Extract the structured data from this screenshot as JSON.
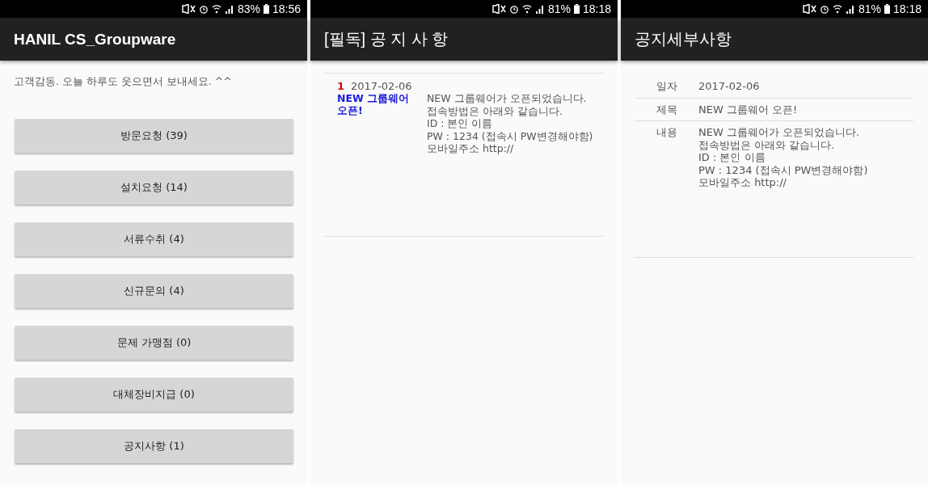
{
  "screens": [
    {
      "kind": "menu",
      "status_bar": {
        "battery": "83%",
        "time": "18:56"
      },
      "app_bar": {
        "title": "HANIL CS_Groupware"
      },
      "greeting": "고객감동. 오늘 하루도 웃으면서 보내세요. ^^",
      "buttons": [
        "방문요청 (39)",
        "설치요청 (14)",
        "서류수취 (4)",
        "신규문의 (4)",
        "문제 가맹점 (0)",
        "대체장비지급 (0)",
        "공지사항 (1)"
      ]
    },
    {
      "kind": "list",
      "status_bar": {
        "battery": "81%",
        "time": "18:18"
      },
      "app_bar": {
        "title": "[필독] 공 지 사 항"
      },
      "notices": [
        {
          "number": "1",
          "date": "2017-02-06",
          "title": "NEW 그룹웨어 오픈!",
          "body": "NEW 그룹웨어가 오픈되었습니다.\n접속방법은 아래와 같습니다.\nID : 본인 이름\nPW : 1234 (접속시 PW변경해야함)\n모바일주소 http://"
        }
      ]
    },
    {
      "kind": "detail",
      "status_bar": {
        "battery": "81%",
        "time": "18:18"
      },
      "app_bar": {
        "title": "공지세부사항"
      },
      "fields": [
        {
          "label": "일자",
          "value": "2017-02-06"
        },
        {
          "label": "제목",
          "value": "NEW 그룹웨어 오픈!"
        },
        {
          "label": "내용",
          "value": "NEW 그룹웨어가 오픈되었습니다.\n접속방법은 아래와 같습니다.\nID : 본인 이름\nPW : 1234 (접속시 PW변경해야함)\n모바일주소 http://"
        }
      ]
    }
  ]
}
